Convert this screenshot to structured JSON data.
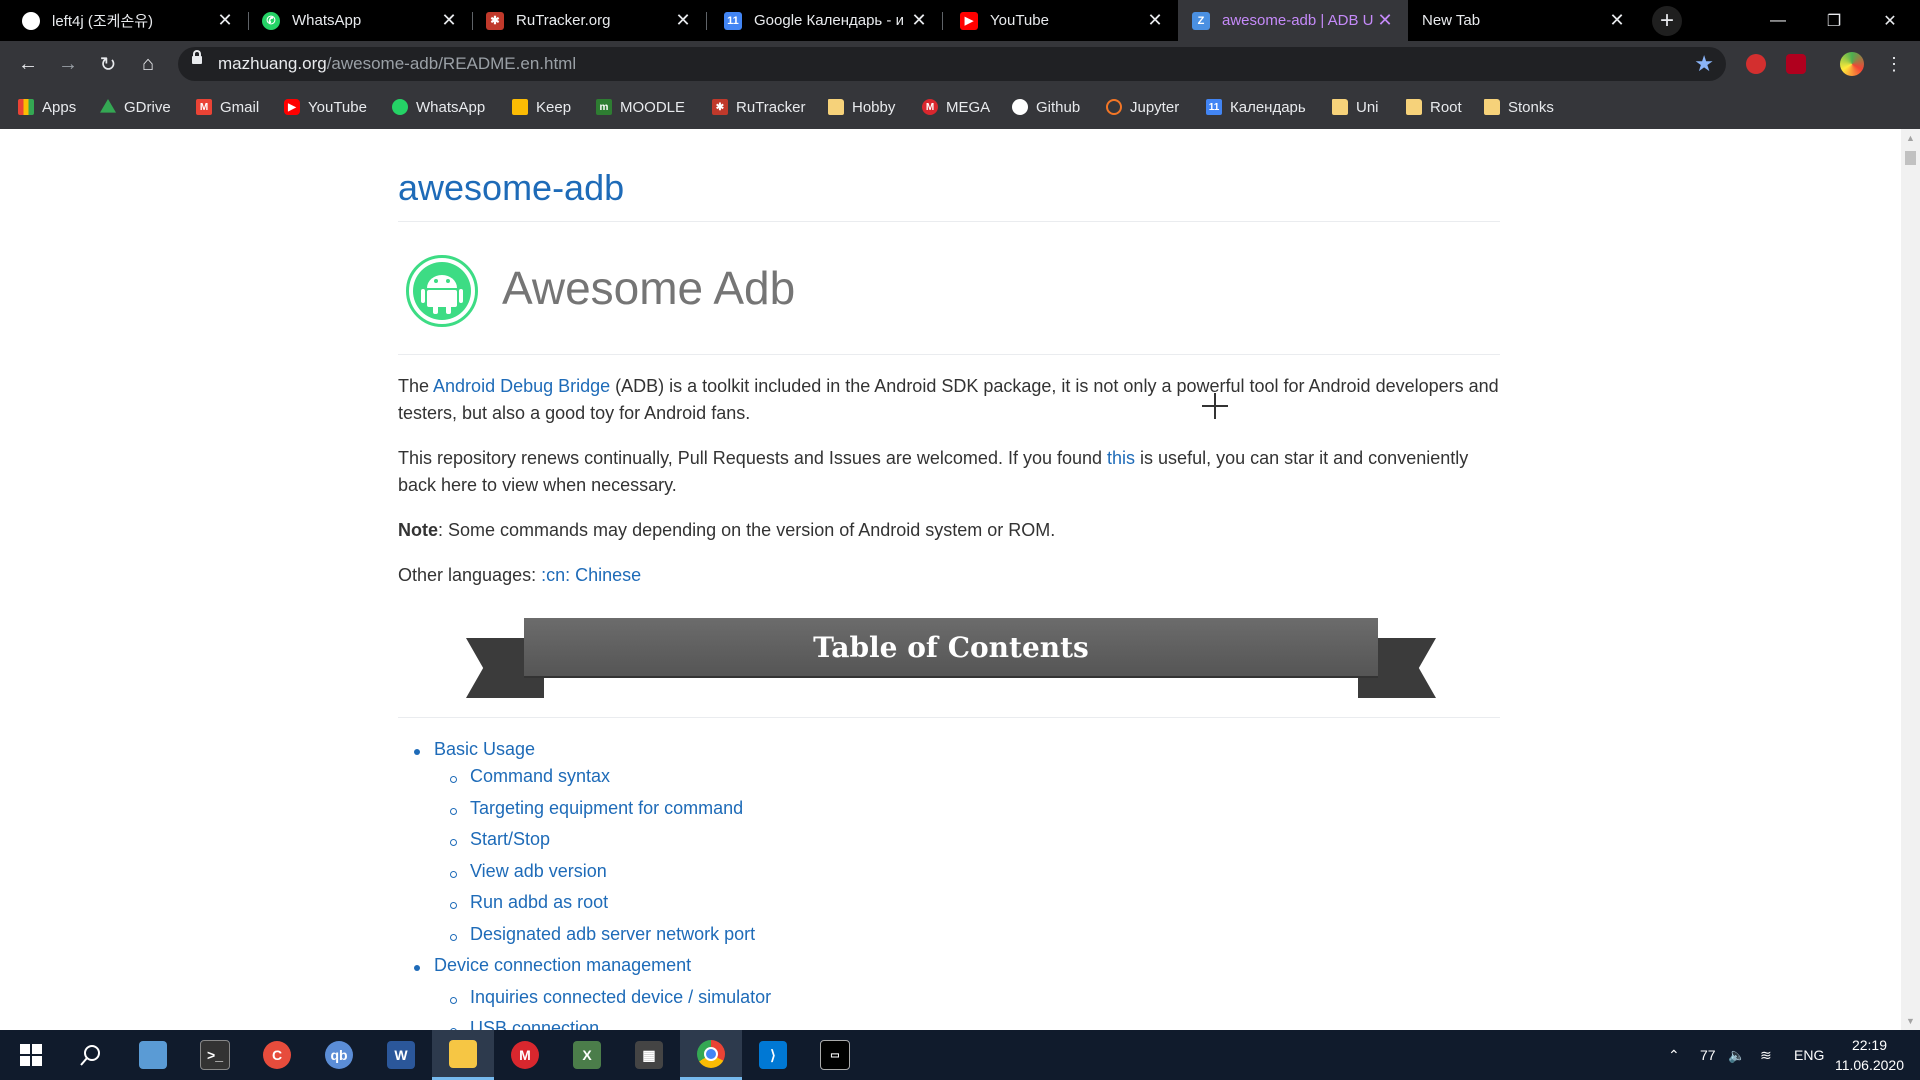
{
  "tabs": [
    {
      "title": "left4j (조케손유)",
      "favicon": "github-icon",
      "color": "#ffffff"
    },
    {
      "title": "WhatsApp",
      "favicon": "whatsapp-icon",
      "color": "#25d366"
    },
    {
      "title": "RuTracker.org",
      "favicon": "rutracker-icon",
      "color": "#c0392b"
    },
    {
      "title": "Google Календарь - и",
      "favicon": "calendar-icon",
      "color": "#4285f4"
    },
    {
      "title": "YouTube",
      "favicon": "youtube-icon",
      "color": "#ff0000"
    },
    {
      "title": "awesome-adb | ADB U",
      "favicon": "adb-page-icon",
      "color": "#4a90e2"
    },
    {
      "title": "New Tab",
      "favicon": "",
      "color": ""
    }
  ],
  "omnibox": {
    "domain": "mazhuang.org",
    "path": "/awesome-adb/README.en.html"
  },
  "bookmarks": [
    {
      "label": "Apps",
      "icon": "apps-grid-icon",
      "color": "#ea4335"
    },
    {
      "label": "GDrive",
      "icon": "gdrive-icon",
      "color": "#34a853"
    },
    {
      "label": "Gmail",
      "icon": "gmail-icon",
      "color": "#ea4335"
    },
    {
      "label": "YouTube",
      "icon": "youtube-icon",
      "color": "#ff0000"
    },
    {
      "label": "WhatsApp",
      "icon": "whatsapp-icon",
      "color": "#25d366"
    },
    {
      "label": "Keep",
      "icon": "keep-icon",
      "color": "#fbbc04"
    },
    {
      "label": "MOODLE",
      "icon": "moodle-icon",
      "color": "#2e7d32"
    },
    {
      "label": "RuTracker",
      "icon": "rutracker-icon",
      "color": "#c0392b"
    },
    {
      "label": "Hobby",
      "icon": "folder-icon",
      "color": "#f6d27a"
    },
    {
      "label": "MEGA",
      "icon": "mega-icon",
      "color": "#d9272e"
    },
    {
      "label": "Github",
      "icon": "github-icon",
      "color": "#ffffff"
    },
    {
      "label": "Jupyter",
      "icon": "jupyter-icon",
      "color": "#f37626"
    },
    {
      "label": "Календарь",
      "icon": "calendar-icon",
      "color": "#4285f4"
    },
    {
      "label": "Uni",
      "icon": "folder-icon",
      "color": "#f6d27a"
    },
    {
      "label": "Root",
      "icon": "folder-icon",
      "color": "#f6d27a"
    },
    {
      "label": "Stonks",
      "icon": "folder-icon",
      "color": "#f6d27a"
    }
  ],
  "page": {
    "h1": "awesome-adb",
    "logo_title": "Awesome Adb",
    "p1_a": "The ",
    "p1_link": "Android Debug Bridge",
    "p1_b": " (ADB) is a toolkit included in the Android SDK package, it is not only a powerful tool for Android developers and testers, but also a good toy for Android fans.",
    "p2_a": "This repository renews continually, Pull Requests and Issues are welcomed. If you found ",
    "p2_link": "this",
    "p2_b": " is useful, you can star it and conveniently back here to view when necessary.",
    "note_label": "Note",
    "note_text": ": Some commands may depending on the version of Android system or ROM.",
    "other_lang_label": "Other languages: ",
    "other_lang_link": ":cn: Chinese",
    "toc_title": "Table of Contents",
    "toc": [
      {
        "label": "Basic Usage",
        "level": 1
      },
      {
        "label": "Command syntax",
        "level": 2
      },
      {
        "label": "Targeting equipment for command",
        "level": 2
      },
      {
        "label": "Start/Stop",
        "level": 2
      },
      {
        "label": "View adb version",
        "level": 2
      },
      {
        "label": "Run adbd as root",
        "level": 2
      },
      {
        "label": "Designated adb server network port",
        "level": 2
      },
      {
        "label": "Device connection management",
        "level": 1
      },
      {
        "label": "Inquiries connected device / simulator",
        "level": 2
      },
      {
        "label": "USB connection",
        "level": 2
      }
    ]
  },
  "taskbar": {
    "apps": [
      "start-icon",
      "search-icon",
      "explorer-app-icon",
      "terminal-icon",
      "ccleaner-icon",
      "qbittorrent-icon",
      "word-icon",
      "file-explorer-icon",
      "mega-icon",
      "excel-game-icon",
      "calculator-icon",
      "chrome-icon",
      "vscode-icon",
      "cmd-icon"
    ],
    "tray_temp": "77",
    "lang": "ENG",
    "time": "22:19",
    "date": "11.06.2020"
  }
}
